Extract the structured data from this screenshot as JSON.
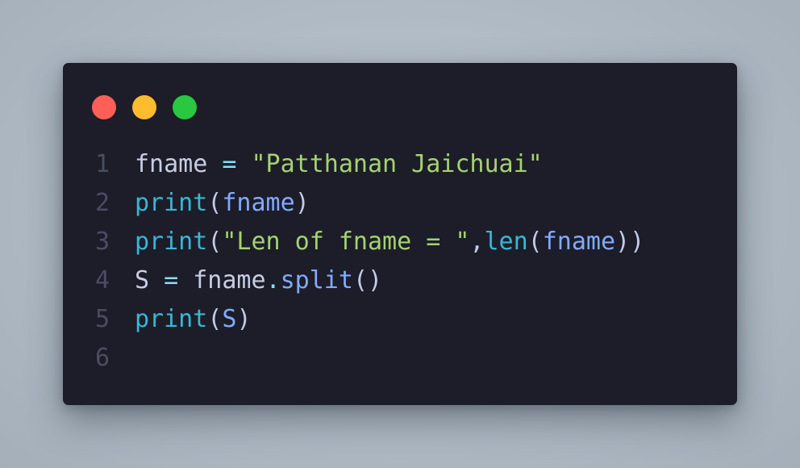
{
  "colors": {
    "background": "#b3bcc6",
    "window": "#1c1d28",
    "close_dot": "#ff5f57",
    "minimize_dot": "#febc2e",
    "maximize_dot": "#28c840",
    "line_number": "#4a4d63",
    "variable": "#c9cde3",
    "operator": "#89ddff",
    "string": "#a5d26f",
    "builtin": "#39b6d6",
    "argument": "#82aaff"
  },
  "window_controls": [
    "close",
    "minimize",
    "maximize"
  ],
  "code": {
    "language": "python",
    "lines": [
      {
        "number": "1",
        "tokens": [
          {
            "text": "fname",
            "kind": "var"
          },
          {
            "text": " ",
            "kind": "var"
          },
          {
            "text": "=",
            "kind": "op"
          },
          {
            "text": " ",
            "kind": "var"
          },
          {
            "text": "\"Patthanan Jaichuai\"",
            "kind": "str"
          }
        ]
      },
      {
        "number": "2",
        "tokens": [
          {
            "text": "print",
            "kind": "fn"
          },
          {
            "text": "(",
            "kind": "punc"
          },
          {
            "text": "fname",
            "kind": "arg"
          },
          {
            "text": ")",
            "kind": "punc"
          }
        ]
      },
      {
        "number": "3",
        "tokens": [
          {
            "text": "print",
            "kind": "fn"
          },
          {
            "text": "(",
            "kind": "punc"
          },
          {
            "text": "\"Len of fname = \"",
            "kind": "str"
          },
          {
            "text": ",",
            "kind": "punc"
          },
          {
            "text": "len",
            "kind": "fn"
          },
          {
            "text": "(",
            "kind": "punc"
          },
          {
            "text": "fname",
            "kind": "arg"
          },
          {
            "text": "))",
            "kind": "punc"
          }
        ]
      },
      {
        "number": "4",
        "tokens": [
          {
            "text": "S",
            "kind": "var"
          },
          {
            "text": " ",
            "kind": "var"
          },
          {
            "text": "=",
            "kind": "op"
          },
          {
            "text": " ",
            "kind": "var"
          },
          {
            "text": "fname",
            "kind": "var"
          },
          {
            "text": ".",
            "kind": "op"
          },
          {
            "text": "split",
            "kind": "method"
          },
          {
            "text": "()",
            "kind": "punc"
          }
        ]
      },
      {
        "number": "5",
        "tokens": [
          {
            "text": "print",
            "kind": "fn"
          },
          {
            "text": "(",
            "kind": "punc"
          },
          {
            "text": "S",
            "kind": "arg"
          },
          {
            "text": ")",
            "kind": "punc"
          }
        ]
      },
      {
        "number": "6",
        "tokens": []
      }
    ]
  }
}
